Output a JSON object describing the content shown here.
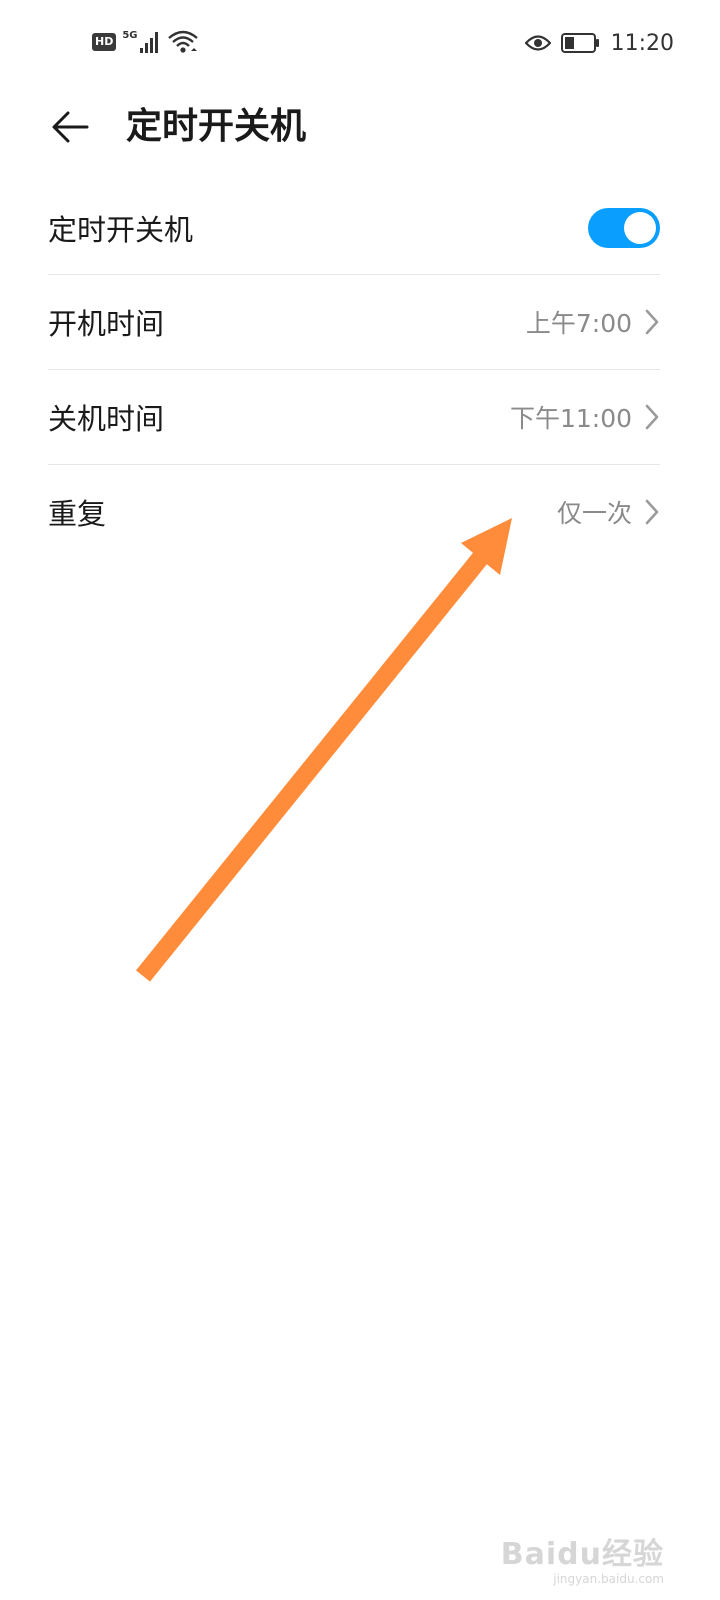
{
  "status_bar": {
    "hd_badge": "HD",
    "network_type": "5G",
    "time": "11:20",
    "icons": [
      "signal-bars-icon",
      "wifi-icon",
      "eye-comfort-icon",
      "battery-icon"
    ]
  },
  "header": {
    "title": "定时开关机"
  },
  "settings": {
    "master": {
      "label": "定时开关机",
      "enabled": true
    },
    "power_on": {
      "label": "开机时间",
      "value": "上午7:00"
    },
    "power_off": {
      "label": "关机时间",
      "value": "下午11:00"
    },
    "repeat": {
      "label": "重复",
      "value": "仅一次"
    }
  },
  "colors": {
    "toggle_on": "#0a9eff",
    "annotation_arrow": "#ff8c3a"
  },
  "watermark": {
    "main": "Baidu经验",
    "sub": "jingyan.baidu.com"
  }
}
